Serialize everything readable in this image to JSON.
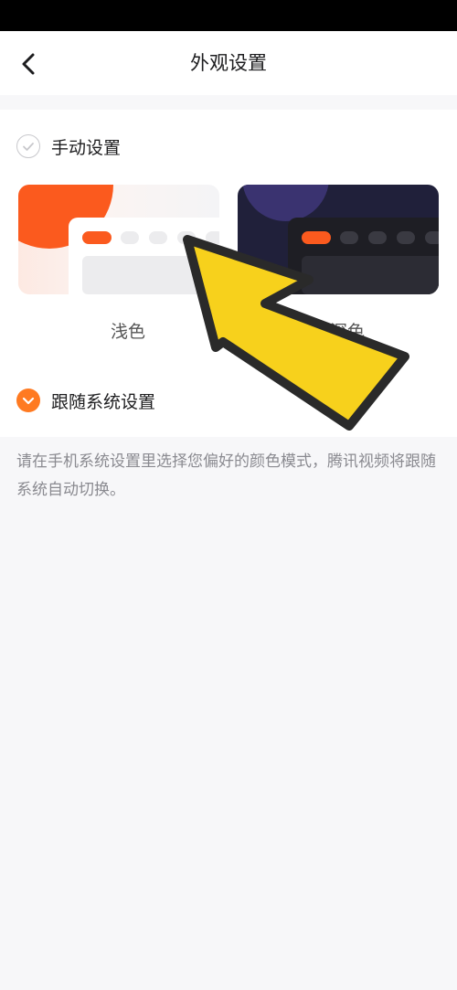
{
  "header": {
    "title": "外观设置",
    "back_icon": "chevron-left-icon"
  },
  "manual": {
    "label": "手动设置",
    "selected": false,
    "themes": [
      {
        "name": "浅色"
      },
      {
        "name": "深色"
      }
    ]
  },
  "follow_system": {
    "label": "跟随系统设置",
    "selected": true,
    "description": "请在手机系统设置里选择您偏好的颜色模式，腾讯视频将跟随系统自动切换。"
  },
  "colors": {
    "accent": "#ff7a21",
    "dark_theme_bg": "#20203a",
    "annotation_arrow": "#f7d11c"
  }
}
